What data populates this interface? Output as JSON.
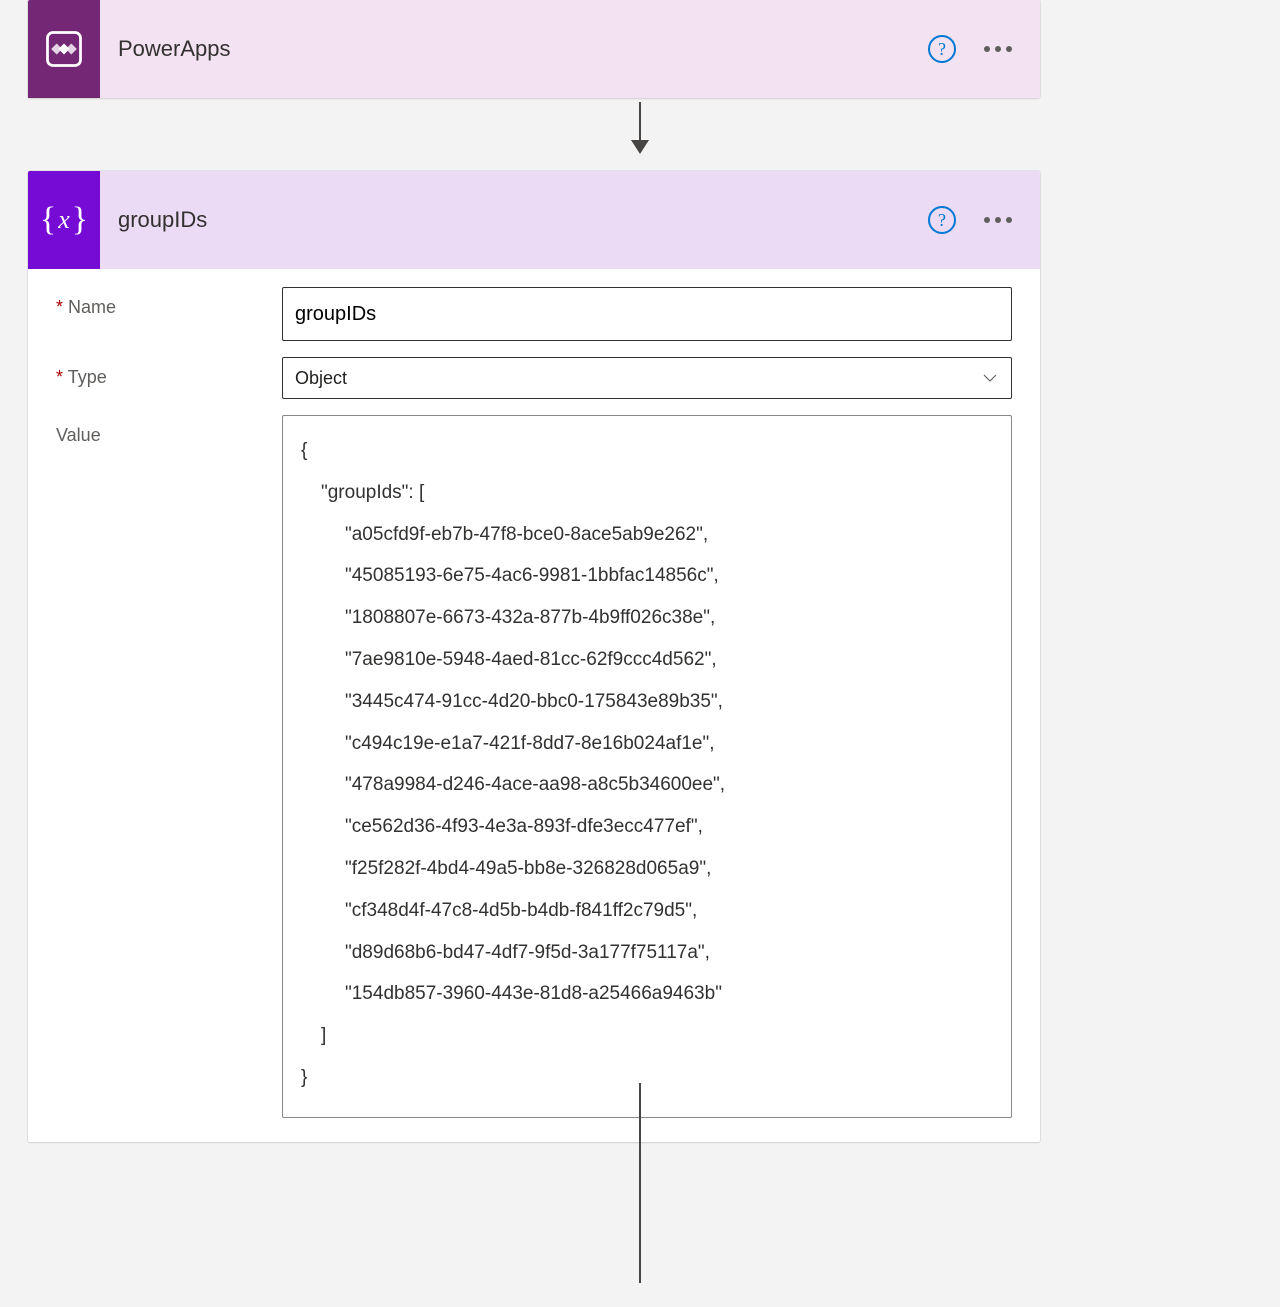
{
  "trigger": {
    "title": "PowerApps"
  },
  "action": {
    "title": "groupIDs",
    "fields": {
      "name_label": "Name",
      "type_label": "Type",
      "value_label": "Value",
      "name_value": "groupIDs",
      "type_value": "Object",
      "value_json": {
        "open": "{",
        "key": "\"groupIds\": [",
        "items": [
          "\"a05cfd9f-eb7b-47f8-bce0-8ace5ab9e262\",",
          "\"45085193-6e75-4ac6-9981-1bbfac14856c\",",
          "\"1808807e-6673-432a-877b-4b9ff026c38e\",",
          "\"7ae9810e-5948-4aed-81cc-62f9ccc4d562\",",
          "\"3445c474-91cc-4d20-bbc0-175843e89b35\",",
          "\"c494c19e-e1a7-421f-8dd7-8e16b024af1e\",",
          "\"478a9984-d246-4ace-aa98-a8c5b34600ee\",",
          "\"ce562d36-4f93-4e3a-893f-dfe3ecc477ef\",",
          "\"f25f282f-4bd4-49a5-bb8e-326828d065a9\",",
          "\"cf348d4f-47c8-4d5b-b4db-f841ff2c79d5\",",
          "\"d89d68b6-bd47-4df7-9f5d-3a177f75117a\",",
          "\"154db857-3960-443e-81d8-a25466a9463b\""
        ],
        "close_arr": "]",
        "close": "}"
      }
    }
  }
}
